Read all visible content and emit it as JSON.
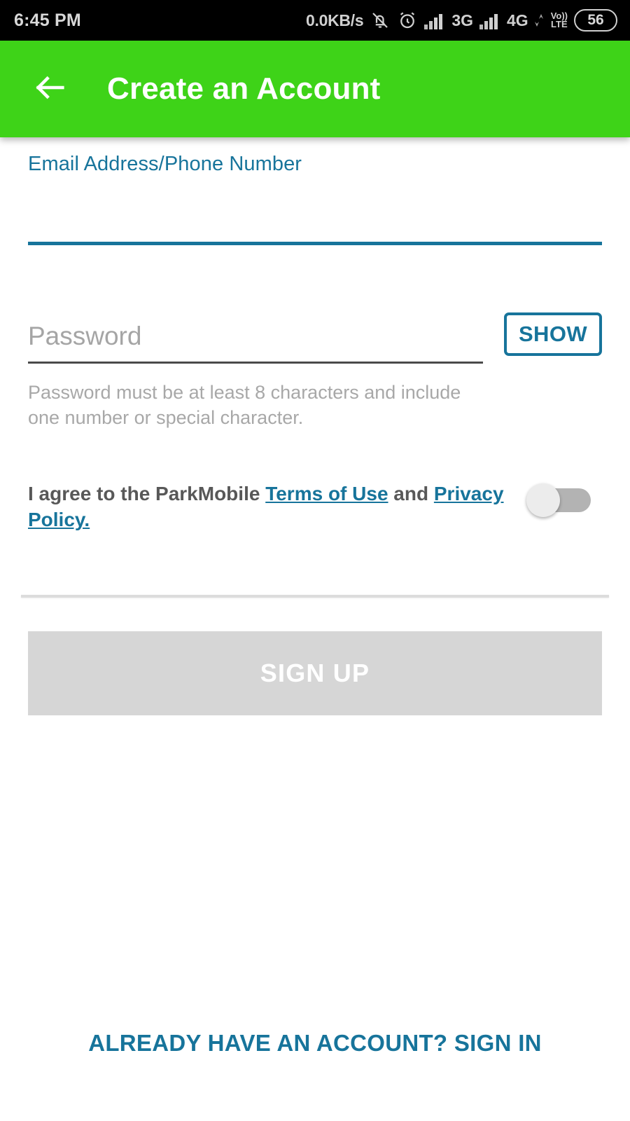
{
  "status_bar": {
    "time": "6:45 PM",
    "network_speed": "0.0KB/s",
    "icons": [
      "bell-muted-icon",
      "alarm-clock-icon",
      "signal-bars-icon",
      "signal-bars-icon"
    ],
    "network_3g": "3G",
    "network_4g": "4G",
    "volte_top": "Vo))",
    "volte_bottom": "LTE",
    "battery_level": "56"
  },
  "app_bar": {
    "back_icon": "back-arrow-icon",
    "title": "Create an Account",
    "background_color": "#3ED318"
  },
  "form": {
    "email": {
      "label": "Email Address/Phone Number",
      "value": "",
      "placeholder": ""
    },
    "password": {
      "label": "",
      "value": "",
      "placeholder": "Password",
      "show_button_label": "SHOW",
      "helper_text": "Password must be at least 8 characters and include one number or special character."
    },
    "terms": {
      "prefix": "I agree to the ParkMobile ",
      "terms_link": "Terms of Use",
      "middle": " and ",
      "privacy_link": "Privacy Policy.",
      "toggle_state": "off"
    },
    "submit_label": "SIGN UP"
  },
  "footer": {
    "signin_label": "ALREADY HAVE AN ACCOUNT? SIGN IN"
  },
  "colors": {
    "brand_green": "#3ED318",
    "accent_teal": "#17749B",
    "disabled_gray": "#d6d6d6"
  }
}
